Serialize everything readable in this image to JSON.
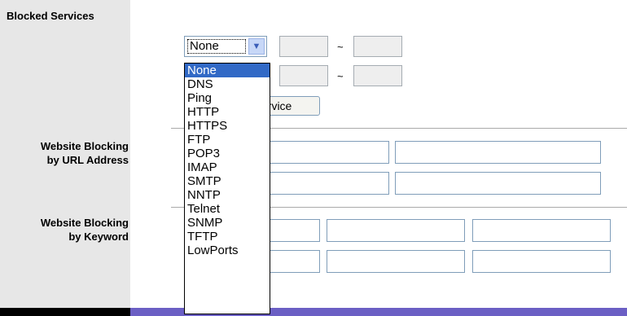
{
  "labels": {
    "blocked_services": "Blocked Services",
    "url_line1": "Website Blocking",
    "url_line2": "by URL Address",
    "kw_line1": "Website Blocking",
    "kw_line2": "by Keyword"
  },
  "service_select": {
    "value": "None",
    "options": [
      "None",
      "DNS",
      "Ping",
      "HTTP",
      "HTTPS",
      "FTP",
      "POP3",
      "IMAP",
      "SMTP",
      "NNTP",
      "Telnet",
      "SNMP",
      "TFTP",
      "LowPorts"
    ]
  },
  "range_separator": "~",
  "add_service_button": "ervice"
}
